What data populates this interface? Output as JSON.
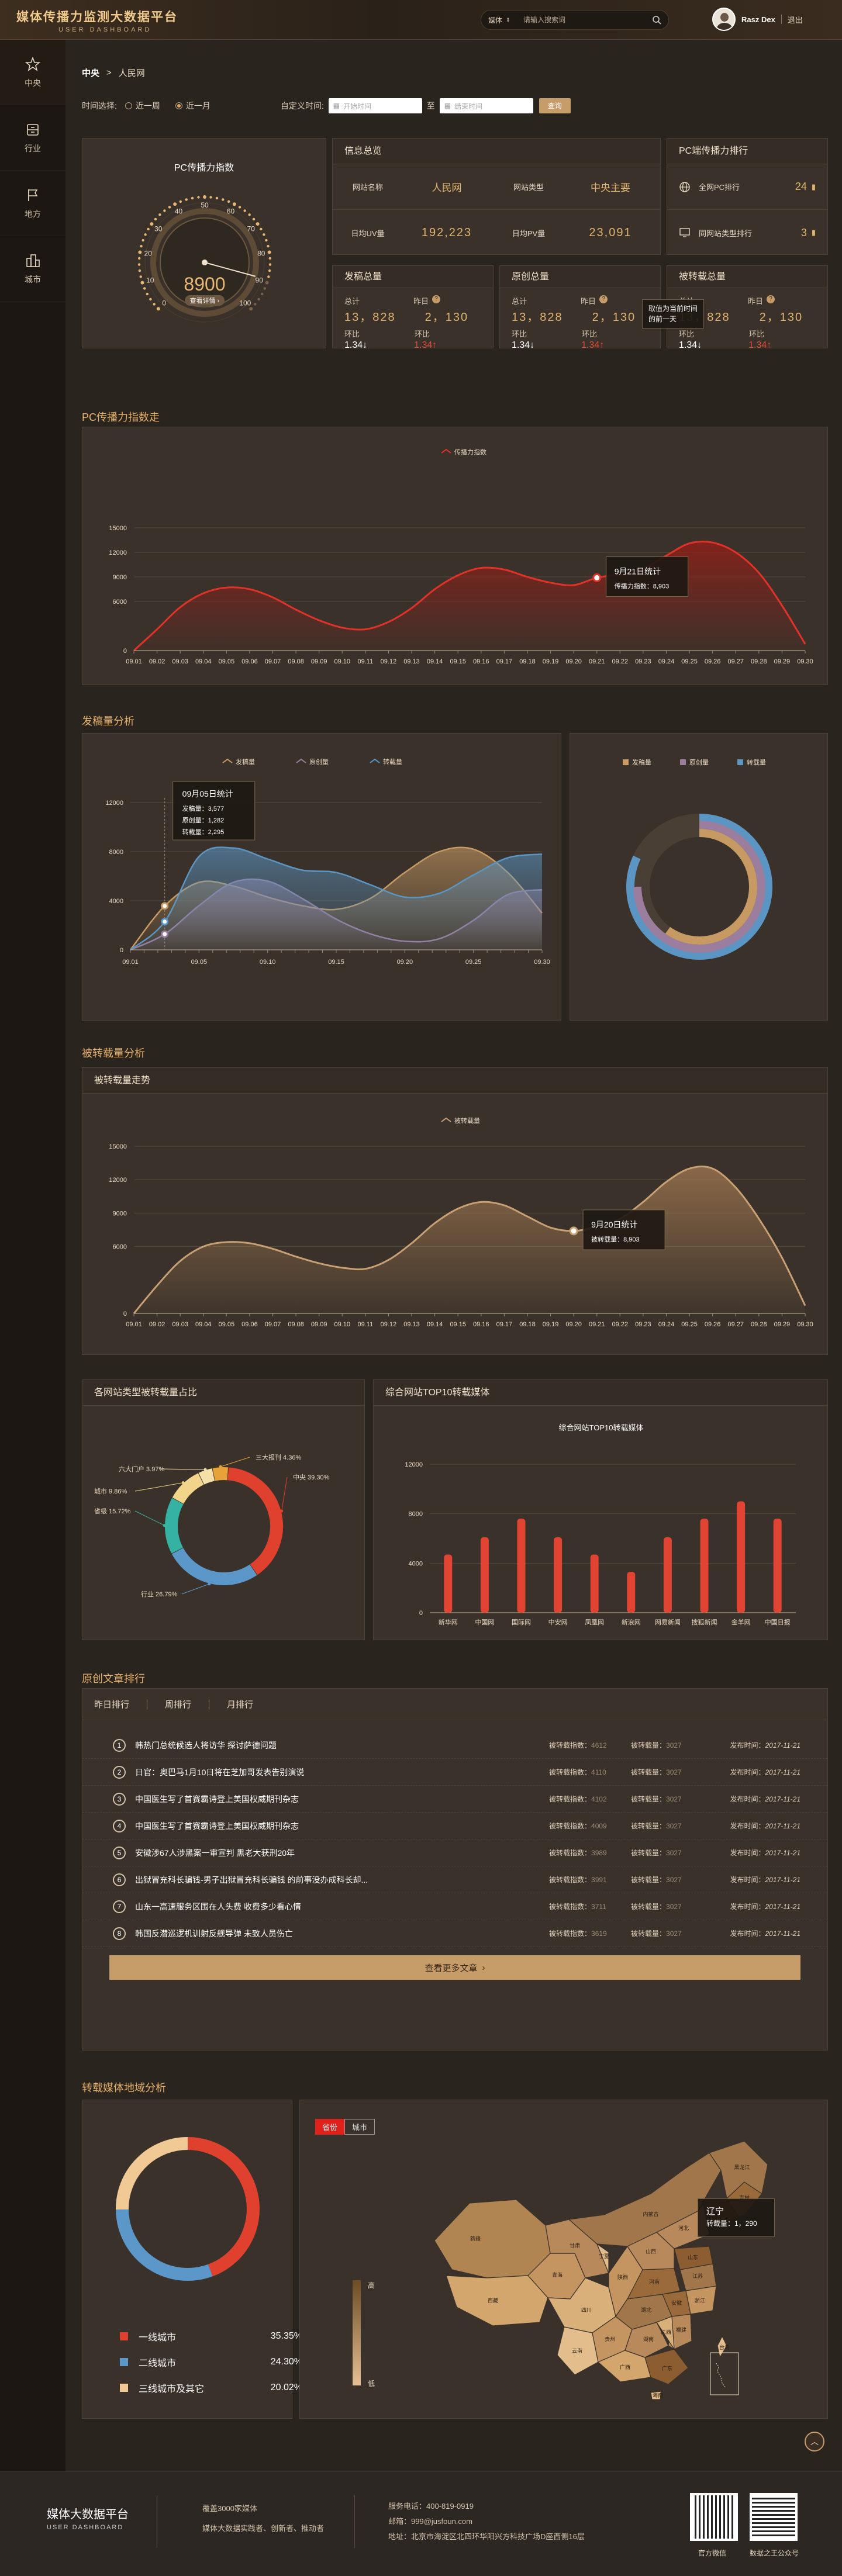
{
  "header": {
    "title": "媒体传播力监测大数据平台",
    "subtitle": "USER DASHBOARD",
    "search_type": "媒体",
    "search_placeholder": "请输入搜索词",
    "user_name": "Rasz Dex",
    "logout": "退出"
  },
  "sidebar": {
    "items": [
      {
        "label": "中央",
        "icon": "star-icon"
      },
      {
        "label": "行业",
        "icon": "cabinet-icon"
      },
      {
        "label": "地方",
        "icon": "flag-icon"
      },
      {
        "label": "城市",
        "icon": "city-icon"
      }
    ]
  },
  "breadcrumb": {
    "root": "中央",
    "sep": ">",
    "current": "人民网"
  },
  "filters": {
    "time_label": "时间选择:",
    "opt_week": "近一周",
    "opt_month": "近一月",
    "custom_label": "自定义时间:",
    "start_placeholder": "开始时间",
    "to": "至",
    "end_placeholder": "结束时间",
    "query": "查询"
  },
  "gauge": {
    "title": "PC传播力指数",
    "value": "8900",
    "label": "查看详情",
    "min": 0,
    "max": 100,
    "level": 0.89,
    "ticks": [
      "0",
      "10",
      "20",
      "30",
      "40",
      "50",
      "60",
      "70",
      "80",
      "90",
      "100"
    ]
  },
  "info": {
    "title": "信息总览",
    "r1": [
      "网站名称",
      "人民网",
      "网站类型",
      "中央主要"
    ],
    "r2": [
      "日均UV量",
      "192,223",
      "日均PV量",
      "23,091"
    ]
  },
  "rank": {
    "title": "PC端传播力排行",
    "r1_label": "全网PC排行",
    "r1_value": "24",
    "r2_label": "同网站类型排行",
    "r2_value": "3"
  },
  "stats": [
    {
      "title": "发稿总量",
      "total_label": "总计",
      "total": "13，828",
      "yest_label": "昨日",
      "yest": "2，130",
      "ring_label": "环比",
      "ring1": "1.34",
      "ring2": "1.34"
    },
    {
      "title": "原创总量",
      "total_label": "总计",
      "total": "13，828",
      "yest_label": "昨日",
      "yest": "2，130",
      "ring_label": "环比",
      "ring1": "1.34",
      "ring2": "1.34"
    },
    {
      "title": "被转载总量",
      "total_label": "总计",
      "total": "13，828",
      "yest_label": "昨日",
      "yest": "2，130",
      "ring_label": "环比",
      "ring1": "1.34",
      "ring2": "1.34"
    }
  ],
  "stat_tooltip": {
    "l1": "取值为当前时间",
    "l2": "的前一天"
  },
  "sections": {
    "pc_trend": "PC传播力指数走",
    "posts": "发稿量分析",
    "reprint": "被转载量分析",
    "original": "原创文章排行",
    "region": "转载媒体地域分析"
  },
  "chart_pc": {
    "type": "area",
    "legend": "传播力指数",
    "x": [
      "09.01",
      "09.02",
      "09.03",
      "09.04",
      "09.05",
      "09.06",
      "09.07",
      "09.08",
      "09.09",
      "09.10",
      "09.11",
      "09.12",
      "09.13",
      "09.14",
      "09.15",
      "09.16",
      "09.17",
      "09.18",
      "09.19",
      "09.20",
      "09.21",
      "09.22",
      "09.23",
      "09.24",
      "09.25",
      "09.26",
      "09.27",
      "09.28",
      "09.29",
      "09.30"
    ],
    "values": [
      0,
      2600,
      5300,
      7000,
      7700,
      7500,
      6500,
      5000,
      3700,
      2800,
      2600,
      3500,
      5200,
      7500,
      9200,
      10100,
      9900,
      9000,
      8300,
      8000,
      8900,
      9300,
      10000,
      11600,
      13100,
      13200,
      12000,
      9500,
      5500,
      800
    ],
    "ylim": [
      0,
      15000
    ],
    "yticks": [
      "0",
      "6000",
      "9000",
      "12000",
      "15000"
    ],
    "tooltip": {
      "title": "9月21日统计",
      "label": "传播力指数：8,903",
      "index": 20
    }
  },
  "chart_posts": {
    "type": "area",
    "series": [
      {
        "name": "发稿量",
        "color": "#c79a63",
        "values": [
          0,
          3577,
          5500,
          5200,
          4300,
          3600,
          3300,
          4200,
          6300,
          8000,
          8200,
          6300,
          3000
        ]
      },
      {
        "name": "原创量",
        "color": "#9b7e9e",
        "values": [
          0,
          1282,
          3600,
          5500,
          5600,
          4200,
          2500,
          1300,
          700,
          900,
          2400,
          4500,
          4900
        ]
      },
      {
        "name": "转载量",
        "color": "#5a95c4",
        "values": [
          0,
          2295,
          7600,
          8300,
          7400,
          6500,
          6300,
          5300,
          4300,
          4600,
          6100,
          7500,
          7800
        ]
      }
    ],
    "xlabels": [
      "09.01",
      "09.05",
      "09.10",
      "09.15",
      "09.20",
      "09.25",
      "09.30"
    ],
    "ylim": [
      0,
      12000
    ],
    "yticks": [
      "0",
      "4000",
      "8000",
      "12000"
    ],
    "tooltip": {
      "title": "09月05日统计",
      "l1": "发稿量：3,577",
      "l2": "原创量：1,282",
      "l3": "转载量：2,295"
    }
  },
  "rings": {
    "legend": [
      "发稿量",
      "原创量",
      "转载量"
    ],
    "values": [
      0.6,
      0.75,
      0.82
    ]
  },
  "chart_reprint": {
    "type": "area",
    "title": "被转载量走势",
    "legend": "被转载量",
    "x": [
      "09.01",
      "09.02",
      "09.03",
      "09.04",
      "09.05",
      "09.06",
      "09.07",
      "09.08",
      "09.09",
      "09.10",
      "09.11",
      "09.12",
      "09.13",
      "09.14",
      "09.15",
      "09.16",
      "09.17",
      "09.18",
      "09.19",
      "09.20",
      "09.21",
      "09.22",
      "09.23",
      "09.24",
      "09.25",
      "09.26",
      "09.27",
      "09.28",
      "09.29",
      "09.30"
    ],
    "values": [
      0,
      2500,
      4700,
      6000,
      6400,
      6300,
      5800,
      5100,
      4500,
      4100,
      4000,
      4800,
      6300,
      8100,
      9400,
      10000,
      9700,
      8700,
      7700,
      7400,
      7800,
      8500,
      10000,
      11800,
      13000,
      13000,
      11300,
      8500,
      5000,
      700
    ],
    "ylim": [
      0,
      15000
    ],
    "yticks": [
      "0",
      "6000",
      "9000",
      "12000",
      "15000"
    ],
    "tooltip": {
      "title": "9月20日统计",
      "label": "被转载量：8,903",
      "index": 19
    }
  },
  "share": {
    "title": "各网站类型被转载量占比",
    "slices": [
      {
        "name": "中央",
        "value": 39.3,
        "label": "中央 39.30%",
        "color": "#e0412e"
      },
      {
        "name": "行业",
        "value": 26.79,
        "label": "行业 26.79%",
        "color": "#5b97c9"
      },
      {
        "name": "省级",
        "value": 15.72,
        "label": "省级 15.72%",
        "color": "#35b2a1"
      },
      {
        "name": "城市",
        "value": 9.86,
        "label": "城市 9.86%",
        "color": "#f2d48b"
      },
      {
        "name": "六大门户",
        "value": 3.97,
        "label": "六大门户 3.97%",
        "color": "#f4e1a8"
      },
      {
        "name": "三大报刊",
        "value": 4.36,
        "label": "三大报刊 4.36%",
        "color": "#e8a23a"
      }
    ]
  },
  "top10": {
    "title": "综合网站TOP10转载媒体",
    "chart_title": "综合网站TOP10转载媒体",
    "categories": [
      "新华网",
      "中国网",
      "国际网",
      "中安网",
      "凤凰网",
      "新浪网",
      "网易新闻",
      "搜狐新闻",
      "金羊网",
      "中国日报"
    ],
    "values": [
      4700,
      6100,
      7600,
      6100,
      4700,
      3300,
      6100,
      7600,
      9000,
      7600
    ],
    "ylim": [
      0,
      12000
    ],
    "yticks": [
      "0",
      "4000",
      "8000",
      "12000"
    ]
  },
  "articles": {
    "tabs": [
      "昨日排行",
      "周排行",
      "月排行"
    ],
    "tr_label": "被转载指数：",
    "rp_label": "被转载量：",
    "date_label": "发布时间：",
    "rows": [
      {
        "no": "1",
        "title": "韩热门总统候选人将访华 探讨萨德问题",
        "tr": "4612",
        "rp": "3027",
        "date": "2017-11-21"
      },
      {
        "no": "2",
        "title": "日官：奥巴马1月10日将在芝加哥发表告别演说",
        "tr": "4110",
        "rp": "3027",
        "date": "2017-11-21"
      },
      {
        "no": "3",
        "title": "中国医生写了首赛霸诗登上美国权威期刊杂志",
        "tr": "4102",
        "rp": "3027",
        "date": "2017-11-21"
      },
      {
        "no": "4",
        "title": "中国医生写了首赛霸诗登上美国权威期刊杂志",
        "tr": "4009",
        "rp": "3027",
        "date": "2017-11-21"
      },
      {
        "no": "5",
        "title": "安徽涉67人涉黑案一审宣判 黑老大获刑20年",
        "tr": "3989",
        "rp": "3027",
        "date": "2017-11-21"
      },
      {
        "no": "6",
        "title": "出狱冒充科长骗钱-男子出狱冒充科长骗钱 的前事没办成科长却...",
        "tr": "3991",
        "rp": "3027",
        "date": "2017-11-21"
      },
      {
        "no": "7",
        "title": "山东一高速服务区围在人头费 收费多少看心情",
        "tr": "3711",
        "rp": "3027",
        "date": "2017-11-21"
      },
      {
        "no": "8",
        "title": "韩国反潜巡逻机训射反舰导弹 未致人员伤亡",
        "tr": "3619",
        "rp": "3027",
        "date": "2017-11-21"
      }
    ],
    "more": "查看更多文章"
  },
  "cities": {
    "legend": [
      {
        "name": "一线城市",
        "value": "35.35%",
        "pct": 35.35,
        "color": "#e0412e"
      },
      {
        "name": "二线城市",
        "value": "24.30%",
        "pct": 24.3,
        "color": "#5b97c9"
      },
      {
        "name": "三线城市及其它",
        "value": "20.02%",
        "pct": 20.02,
        "color": "#f0c995"
      }
    ]
  },
  "map": {
    "tab_province": "省份",
    "tab_city": "城市",
    "scale_high": "高",
    "scale_low": "低",
    "tooltip_title": "辽宁",
    "tooltip_value": "转载量：1，290",
    "regions": [
      "新疆",
      "西藏",
      "青海",
      "甘肃",
      "内蒙古",
      "四川",
      "云南",
      "贵州",
      "广西",
      "广东",
      "湖南",
      "湖北",
      "河南",
      "山东",
      "辽宁",
      "吉林",
      "黑龙江",
      "河北",
      "江苏",
      "浙江",
      "福建",
      "江西",
      "安徽",
      "陕西",
      "山西",
      "宁夏",
      "台湾",
      "海南"
    ]
  },
  "footer": {
    "title": "媒体大数据平台",
    "subtitle": "USER DASHBOARD",
    "l1": "覆盖3000家媒体",
    "l2": "媒体大数据实践者、创新者、推动者",
    "phone": "服务电话：400-819-0919",
    "mail": "邮箱：999@jusfoun.com",
    "addr": "地址：北京市海淀区北四环华阳兴方科技广场D座西侧16层",
    "qr1": "官方微信",
    "qr2": "数据之王公众号"
  },
  "colors": {
    "accent": "#e1b36e",
    "red": "#e04a36",
    "bar_red": "#e24433"
  }
}
